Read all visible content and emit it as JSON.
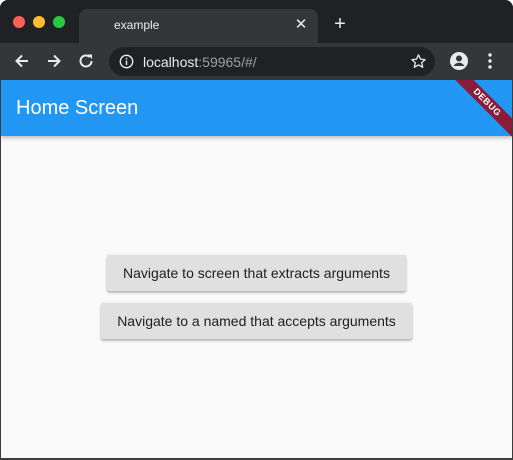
{
  "browser": {
    "tab_title": "example",
    "tab_close": "✕",
    "new_tab": "+",
    "url_host": "localhost",
    "url_rest": ":59965/#/"
  },
  "app": {
    "title": "Home Screen",
    "debug_banner": "DEBUG",
    "buttons": [
      {
        "label": "Navigate to screen that extracts arguments"
      },
      {
        "label": "Navigate to a named that accepts arguments"
      }
    ]
  },
  "colors": {
    "appbar": "#2196f3",
    "debug_banner": "#8a1c3a",
    "button_bg": "#e0e0e0"
  }
}
